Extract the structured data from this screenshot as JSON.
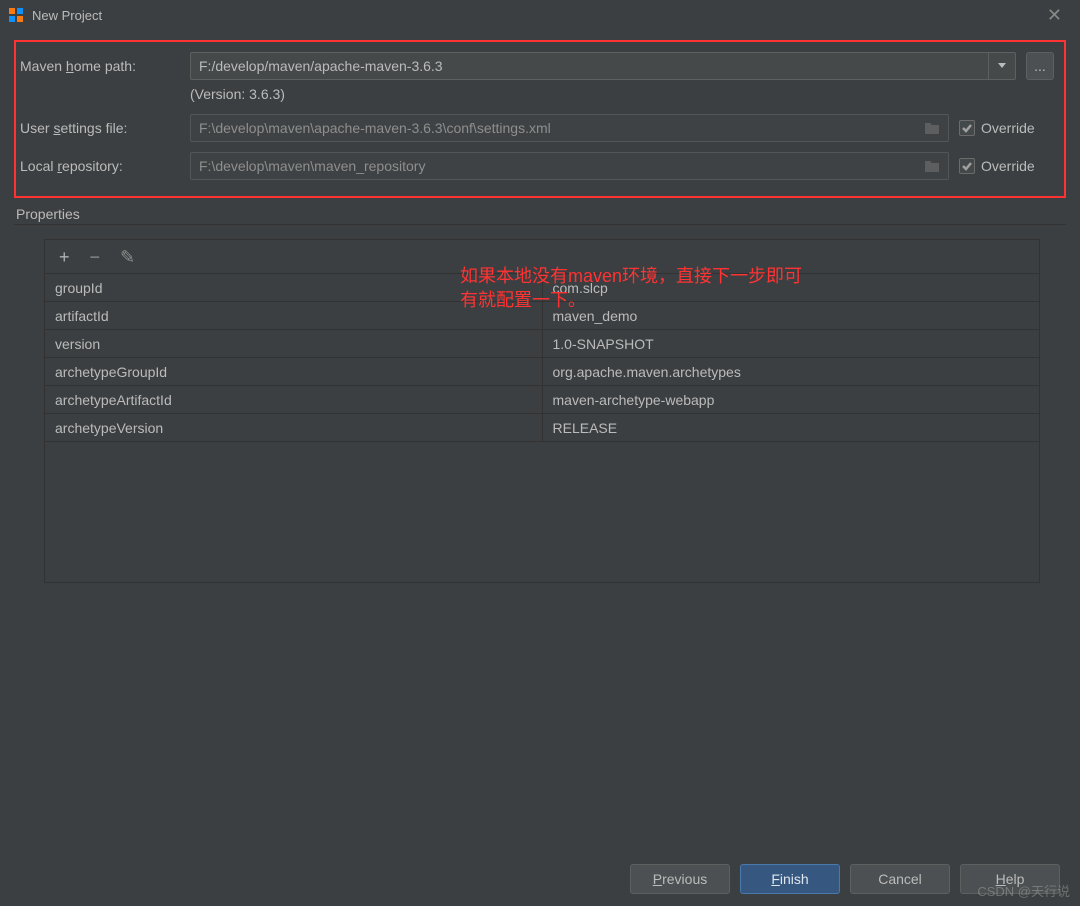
{
  "window": {
    "title": "New Project"
  },
  "fields": {
    "mavenHome": {
      "label_pre": "Maven ",
      "label_mn": "h",
      "label_post": "ome path:",
      "value": "F:/develop/maven/apache-maven-3.6.3",
      "version": "(Version: 3.6.3)"
    },
    "userSettings": {
      "label_pre": "User ",
      "label_mn": "s",
      "label_post": "ettings file:",
      "value": "F:\\develop\\maven\\apache-maven-3.6.3\\conf\\settings.xml",
      "override": "Override"
    },
    "localRepo": {
      "label_pre": "Local ",
      "label_mn": "r",
      "label_post": "epository:",
      "value": "F:\\develop\\maven\\maven_repository",
      "override": "Override"
    }
  },
  "propertiesHeader": "Properties",
  "properties": [
    {
      "k": "groupId",
      "v": "com.slcp"
    },
    {
      "k": "artifactId",
      "v": "maven_demo"
    },
    {
      "k": "version",
      "v": "1.0-SNAPSHOT"
    },
    {
      "k": "archetypeGroupId",
      "v": "org.apache.maven.archetypes"
    },
    {
      "k": "archetypeArtifactId",
      "v": "maven-archetype-webapp"
    },
    {
      "k": "archetypeVersion",
      "v": "RELEASE"
    }
  ],
  "annotation": {
    "line1": "如果本地没有maven环境，直接下一步即可",
    "line2": "有就配置一下。"
  },
  "buttons": {
    "previous": {
      "mn": "P",
      "rest": "revious"
    },
    "finish": {
      "mn": "F",
      "rest": "inish"
    },
    "cancel": {
      "txt": "Cancel"
    },
    "help": {
      "mn": "H",
      "rest": "elp"
    }
  },
  "browse_btn": "...",
  "watermark": "CSDN @天行说"
}
